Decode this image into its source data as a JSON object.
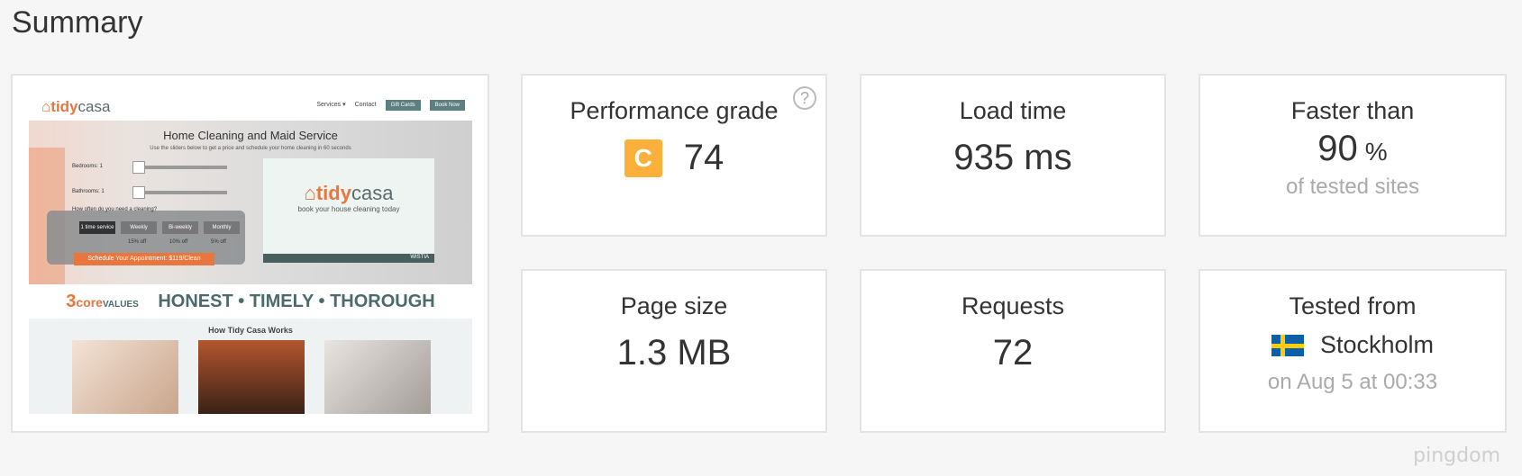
{
  "page": {
    "title": "Summary"
  },
  "screenshot": {
    "logo": {
      "accent": "tidy",
      "rest": "casa"
    },
    "nav": {
      "services": "Services ▾",
      "contact": "Contact",
      "gift_cards": "Gift Cards",
      "book_now": "Book Now"
    },
    "hero": {
      "title": "Home Cleaning and Maid Service",
      "subtitle": "Use the sliders below to get a price and schedule your home cleaning in 60 seconds",
      "bedrooms": "Bedrooms: 1",
      "bathrooms": "Bathrooms: 1",
      "question": "How often do you need a cleaning?",
      "options": [
        "1 time service",
        "Weekly",
        "Bi-weekly",
        "Monthly"
      ],
      "discounts": [
        "15% off",
        "10% off",
        "5% off"
      ],
      "cta": "Schedule Your Appointment: $119/Clean",
      "video_tagline": "book your house cleaning today",
      "video_brand": "WISTIA"
    },
    "values": {
      "number": "3",
      "core": "core",
      "values_word": "VALUES",
      "tagline": "HONEST • TIMELY • THOROUGH"
    },
    "how_it_works": "How Tidy Casa Works"
  },
  "metrics": {
    "grade": {
      "label": "Performance grade",
      "letter": "C",
      "score": "74",
      "help": "?"
    },
    "load_time": {
      "label": "Load time",
      "value": "935 ms"
    },
    "faster_than": {
      "label": "Faster than",
      "value": "90",
      "unit": "%",
      "sub": "of tested sites"
    },
    "page_size": {
      "label": "Page size",
      "value": "1.3 MB"
    },
    "requests": {
      "label": "Requests",
      "value": "72"
    },
    "tested_from": {
      "label": "Tested from",
      "city": "Stockholm",
      "flag": "sweden-flag-icon",
      "sub": "on Aug 5 at 00:33"
    }
  },
  "brand": "pingdom",
  "colors": {
    "grade_badge": "#fbb03b",
    "accent_orange": "#e8763d",
    "muted": "#aaaaaa"
  }
}
